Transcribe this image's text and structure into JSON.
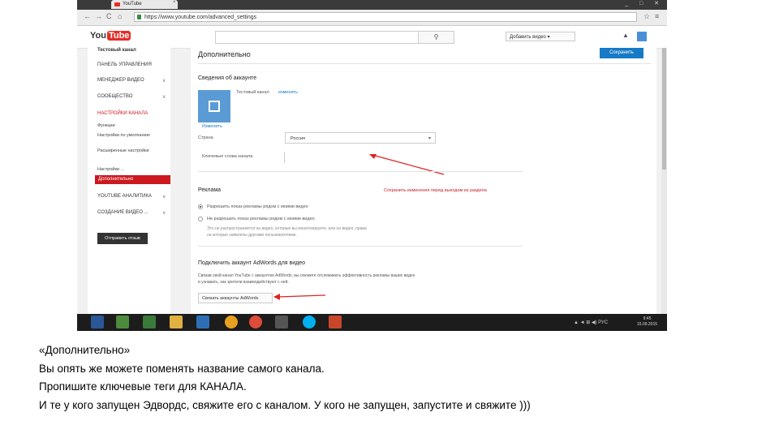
{
  "browser": {
    "tab_title": "YouTube",
    "url": "https://www.youtube.com/advanced_settings",
    "nav_back": "←",
    "nav_forward": "→",
    "nav_reload": "C",
    "nav_home": "⌂",
    "star": "☆",
    "menu": "≡",
    "window_controls": "_ □ ✕"
  },
  "header": {
    "logo_you": "You",
    "logo_tube": "Tube",
    "search_button": "⚲",
    "upload_button": "Добавить видео ▾",
    "bell": "▲"
  },
  "sidebar": {
    "channel_name": "Тестовый канал",
    "items": [
      {
        "label": "ПАНЕЛЬ УПРАВЛЕНИЯ",
        "style": "normal"
      },
      {
        "label": "МЕНЕДЖЕР ВИДЕО",
        "style": "normal",
        "chevron": "∨"
      },
      {
        "label": "СООБЩЕСТВО",
        "style": "normal",
        "chevron": "∨"
      },
      {
        "label": "НАСТРОЙКИ КАНАЛА",
        "style": "red"
      }
    ],
    "subitems": [
      "Функции",
      "Настройки по умолчанию",
      "Расширенные настройки",
      "Настройки ..."
    ],
    "selected": "Дополнительно",
    "more_items": [
      {
        "label": "YOUTUBE АНАЛИТИКА",
        "chevron": "∨"
      },
      {
        "label": "СОЗДАНИЕ ВИДЕО ...",
        "chevron": "∨"
      }
    ],
    "feedback_button": "Отправить отзыв"
  },
  "main": {
    "title": "Дополнительно",
    "save_button": "Сохранить",
    "account_section": "Сведения об аккаунте",
    "account_line": "Тестовый канал",
    "account_link": "изменить",
    "icon_caption": "Изменить",
    "country_label": "Страна",
    "country_value": "Россия",
    "country_chevron": "▾",
    "keywords_label": "Ключевые слова канала",
    "ads_section": "Реклама",
    "ads_note": "Сохранить изменения перед выходом из раздела",
    "radio1": "Разрешить показ рекламы рядом с моими видео",
    "radio2": "Не разрешать показ рекламы рядом с моими видео",
    "radio_desc1": "Это не распространяется на видео, которые вы монетизируете, или на видео, права",
    "radio_desc2": "на которые заявлены другими пользователями.",
    "adwords_section": "Подключить аккаунт AdWords для видео",
    "adwords_desc1": "Связав свой канал YouTube с аккаунтом AdWords, вы сможете отслеживать эффективность рекламы ваших видео",
    "adwords_desc2": "и узнавать, как зрители взаимодействуют с ней.",
    "adwords_button": "Связать аккаунты AdWords"
  },
  "taskbar": {
    "tray": "▲ ◄ ⊞ ◀) РУС",
    "time": "9:45",
    "date": "15.09.2015"
  },
  "caption": [
    "«Дополнительно»",
    "Вы опять же можете поменять название самого канала.",
    "Пропишите ключевые теги для КАНАЛА.",
    "И те у кого запущен Эдвордс, свяжите его с каналом. У кого не запущен, запустите и свяжите )))"
  ],
  "colors": {
    "youtube_red": "#cc181e",
    "link_blue": "#167ac6",
    "arrow_red": "#d22"
  }
}
